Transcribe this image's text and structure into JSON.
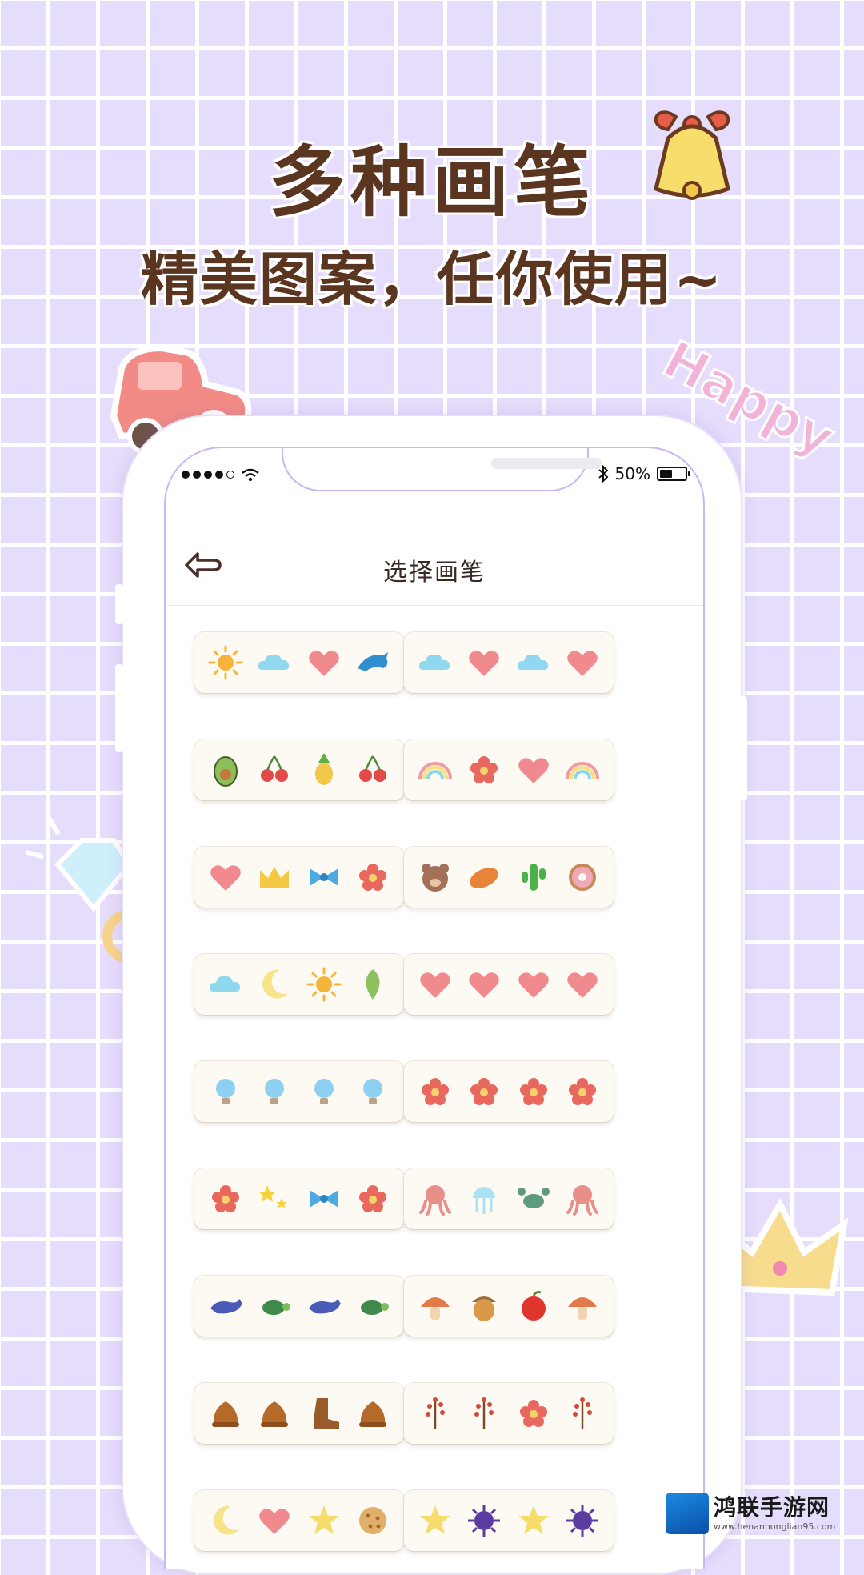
{
  "headline": {
    "title": "多种画笔",
    "subtitle": "精美图案，任你使用~"
  },
  "stickers": {
    "happy_text": "Happy"
  },
  "status_bar": {
    "signal_dots": 5,
    "signal_filled": 4,
    "battery_text": "50%",
    "battery_level": 0.5
  },
  "app": {
    "back_icon": "back-arrow-icon",
    "title": "选择画笔"
  },
  "brush_cards": [
    [
      "sun-icon",
      "cloud-icon",
      "heart-icon",
      "dolphin-icon"
    ],
    [
      "cloud-icon",
      "heart-icon",
      "cloud-icon",
      "heart-icon"
    ],
    [
      "avocado-icon",
      "cherry-icon",
      "pineapple-icon",
      "cherry-icon"
    ],
    [
      "rainbow-icon",
      "flower-icon",
      "heart-icon",
      "rainbow-icon"
    ],
    [
      "heart-icon",
      "crown-icon",
      "bow-icon",
      "flower-icon"
    ],
    [
      "bear-icon",
      "bread-icon",
      "cactus-icon",
      "donut-icon"
    ],
    [
      "cloud-icon",
      "moon-icon",
      "sun-icon",
      "leaf-icon"
    ],
    [
      "heart-icon",
      "heart-icon",
      "heart-icon",
      "heart-icon"
    ],
    [
      "bulb-icon",
      "bulb-icon",
      "bulb-icon",
      "bulb-icon"
    ],
    [
      "flower-icon",
      "flower-icon",
      "flower-icon",
      "flower-icon"
    ],
    [
      "flower-icon",
      "stars-icon",
      "bow-icon",
      "flower-icon"
    ],
    [
      "octopus-icon",
      "jellyfish-icon",
      "crab-icon",
      "octopus-icon"
    ],
    [
      "whale-icon",
      "turtle-icon",
      "whale-icon",
      "turtle-icon"
    ],
    [
      "mushroom-icon",
      "acorn-icon",
      "apple-icon",
      "mushroom-icon"
    ],
    [
      "hat-icon",
      "hat-icon",
      "boot-icon",
      "hat-icon"
    ],
    [
      "twig-icon",
      "twig-icon",
      "flower-icon",
      "twig-icon"
    ],
    [
      "moon-icon",
      "heart-icon",
      "star-icon",
      "cookie-icon"
    ],
    [
      "star-icon",
      "virus-icon",
      "star-icon",
      "virus-icon"
    ]
  ],
  "colors": {
    "background": "#e6dcfb",
    "headline": "#5a3520",
    "phone_border": "#c9b6f2",
    "card": "#fdfaf4"
  },
  "watermark": {
    "name": "鸿联手游网",
    "url": "www.henanhonglian95.com"
  }
}
